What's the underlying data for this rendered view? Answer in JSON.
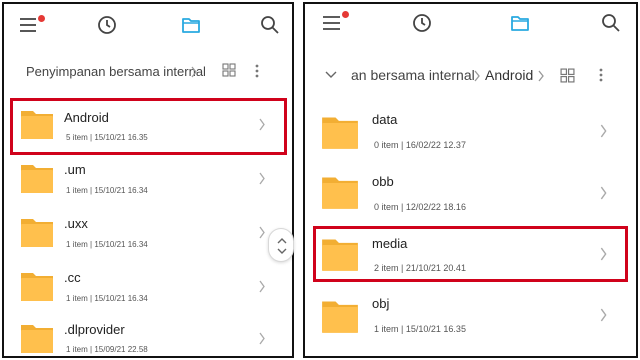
{
  "left": {
    "breadcrumb": "Penyimpanan bersama internal",
    "items": [
      {
        "name": "Android",
        "count": "5 item",
        "date": "15/10/21 16.35"
      },
      {
        "name": ".um",
        "count": "1 item",
        "date": "15/10/21 16.34"
      },
      {
        "name": ".uxx",
        "count": "1 item",
        "date": "15/10/21 16.34"
      },
      {
        "name": ".cc",
        "count": "1 item",
        "date": "15/10/21 16.34"
      },
      {
        "name": ".dlprovider",
        "count": "1 item",
        "date": "15/09/21 22.58"
      }
    ]
  },
  "right": {
    "breadcrumb_parent": "an bersama internal",
    "breadcrumb_current": "Android",
    "items": [
      {
        "name": "data",
        "count": "0 item",
        "date": "16/02/22 12.37"
      },
      {
        "name": "obb",
        "count": "0 item",
        "date": "12/02/22 18.16"
      },
      {
        "name": "media",
        "count": "2 item",
        "date": "21/10/21 20.41"
      },
      {
        "name": "obj",
        "count": "1 item",
        "date": "15/10/21 16.35"
      }
    ]
  },
  "meta_separator": "|",
  "icons": {
    "menu": "menu-icon",
    "recent": "clock-icon",
    "files": "folder-tab-icon",
    "search": "search-icon",
    "view": "grid-view-icon",
    "more": "more-vertical-icon",
    "collapse": "chevron-down-icon",
    "row_arrow": "chevron-right-icon",
    "scroll": "scroll-handle-icon"
  },
  "colors": {
    "folder": "#FFC04D",
    "folder_tab": "#F2AE33",
    "accent_blue": "#29A9E0",
    "highlight_red": "#D0021B",
    "notification_dot": "#E53935"
  }
}
